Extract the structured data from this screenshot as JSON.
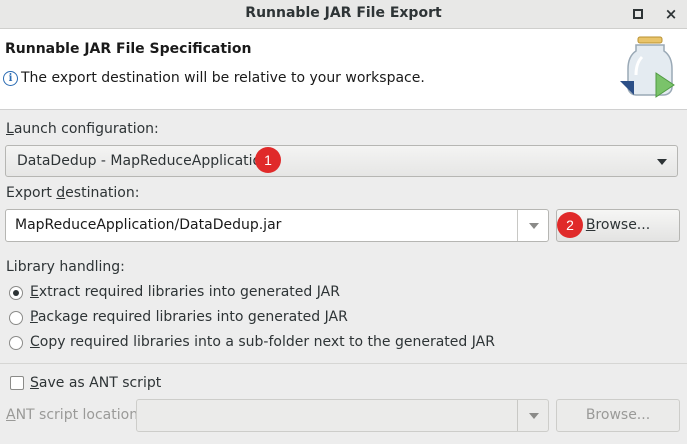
{
  "window": {
    "title": "Runnable JAR File Export",
    "maximize_icon": "maximize-icon",
    "close_glyph": "×"
  },
  "header": {
    "heading": "Runnable JAR File Specification",
    "info_icon_glyph": "i",
    "info_text": "The export destination will be relative to your workspace.",
    "graphic_icon": "jar-export-wizard-icon"
  },
  "launch": {
    "label_mnemonic": "L",
    "label_rest": "aunch configuration:",
    "selected": "DataDedup - MapReduceApplication",
    "badge": "1"
  },
  "export": {
    "label_pre": "Export ",
    "label_mnemonic": "d",
    "label_rest": "estination:",
    "value": "MapReduceApplication/DataDedup.jar",
    "badge": "2",
    "browse_mnemonic": "B",
    "browse_rest": "rowse..."
  },
  "library": {
    "label": "Library handling:",
    "options": [
      {
        "mnemonic": "E",
        "rest": "xtract required libraries into generated JAR",
        "checked": true
      },
      {
        "mnemonic": "P",
        "rest": "ackage required libraries into generated JAR",
        "checked": false
      },
      {
        "mnemonic": "C",
        "rest": "opy required libraries into a sub-folder next to the generated JAR",
        "checked": false
      }
    ]
  },
  "ant": {
    "save_mnemonic": "S",
    "save_rest": "ave as ANT script",
    "save_checked": false,
    "location_mnemonic": "A",
    "location_rest": "NT script location:",
    "location_value": "",
    "browse_label": "Browse..."
  },
  "colors": {
    "badge": "#e02a2a",
    "info": "#2a6bb3",
    "jar_green": "#5cb85c"
  }
}
